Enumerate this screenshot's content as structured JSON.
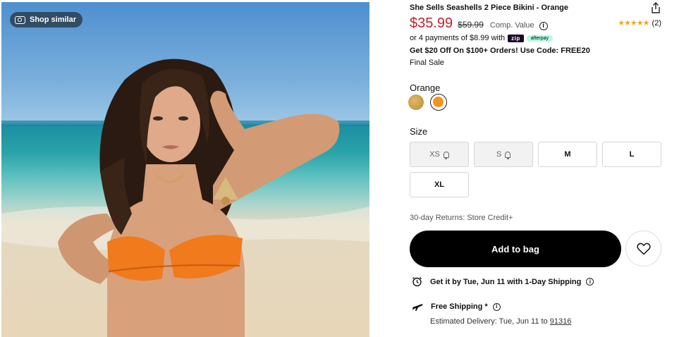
{
  "image": {
    "shop_similar_label": "Shop similar"
  },
  "product": {
    "title": "She Sells Seashells 2 Piece Bikini - Orange",
    "price": "$35.99",
    "compare_price": "$59.99",
    "compare_label": "Comp. Value",
    "rating_count": "(2)",
    "rating_stars": 5,
    "installments_text": "or 4 payments of $8.99 with",
    "zip_badge": "zip",
    "afterpay_badge": "afterpay",
    "promo": "Get $20 Off On $100+ Orders! Use Code: FREE20",
    "final_sale": "Final Sale"
  },
  "color": {
    "label": "Orange",
    "options": [
      "Gold",
      "Orange"
    ],
    "selected": "Orange",
    "swatch_colors": {
      "gold": "#c99d45",
      "orange": "#f7931d"
    }
  },
  "size": {
    "label": "Size",
    "options": [
      {
        "label": "XS",
        "available": false
      },
      {
        "label": "S",
        "available": false
      },
      {
        "label": "M",
        "available": true
      },
      {
        "label": "L",
        "available": true
      },
      {
        "label": "XL",
        "available": true
      }
    ]
  },
  "returns": "30-day Returns: Store Credit+",
  "add_to_bag_label": "Add to bag",
  "shipping": {
    "fast_label": "Get it by Tue, Jun 11 with 1-Day Shipping",
    "free_label": "Free Shipping *",
    "estimate_label": "Estimated Delivery: Tue, Jun 11 to",
    "zipcode": "91316"
  },
  "colors": {
    "price": "#c4202d",
    "button": "#000000",
    "star": "#e7a82b"
  }
}
